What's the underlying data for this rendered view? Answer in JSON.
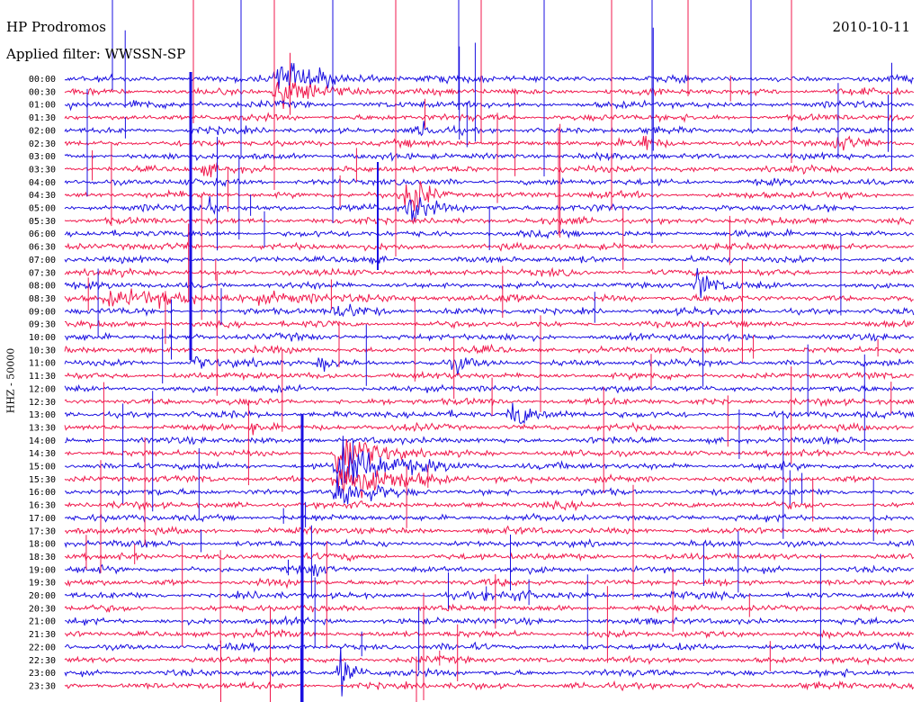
{
  "header": {
    "station": "HP Prodromos",
    "filter": "Applied filter: WWSSN-SP",
    "date": "2010-10-11",
    "channel": "HHZ - 50000"
  },
  "colors": {
    "trace_a": "#1a0fe0",
    "trace_b": "#f0184c",
    "background": "#ffffff",
    "text": "#000000"
  },
  "chart_data": {
    "type": "line",
    "title": "HP Prodromos",
    "subtitle": "Applied filter: WWSSN-SP",
    "date": "2010-10-11",
    "ylabel": "HHZ - 50000",
    "grid": false,
    "rows": [
      "00:00",
      "00:30",
      "01:00",
      "01:30",
      "02:00",
      "02:30",
      "03:00",
      "03:30",
      "04:00",
      "04:30",
      "05:00",
      "05:30",
      "06:00",
      "06:30",
      "07:00",
      "07:30",
      "08:00",
      "08:30",
      "09:00",
      "09:30",
      "10:00",
      "10:30",
      "11:00",
      "11:30",
      "12:00",
      "12:30",
      "13:00",
      "13:30",
      "14:00",
      "14:30",
      "15:00",
      "15:30",
      "16:00",
      "16:30",
      "17:00",
      "17:30",
      "18:00",
      "18:30",
      "19:00",
      "19:30",
      "20:00",
      "20:30",
      "21:00",
      "21:30",
      "22:00",
      "22:30",
      "23:00",
      "23:30"
    ],
    "row_span_minutes": 30,
    "series": [
      {
        "color": "blue",
        "rows": "even (00 minutes)"
      },
      {
        "color": "red",
        "rows": "odd (30 minutes)"
      }
    ],
    "events": [
      {
        "row": "00:00",
        "x_fraction": 0.25,
        "amplitude": 2.2,
        "spread": 0.045
      },
      {
        "row": "00:30",
        "x_fraction": 0.25,
        "amplitude": 1.8,
        "spread": 0.04
      },
      {
        "row": "01:00",
        "x_fraction": 0.08,
        "amplitude": 0.8,
        "spread": 0.02
      },
      {
        "row": "02:00",
        "x_fraction": 0.42,
        "amplitude": 1.0,
        "spread": 0.01
      },
      {
        "row": "02:30",
        "x_fraction": 0.68,
        "amplitude": 1.1,
        "spread": 0.01
      },
      {
        "row": "02:30",
        "x_fraction": 0.91,
        "amplitude": 1.3,
        "spread": 0.012
      },
      {
        "row": "03:30",
        "x_fraction": 0.165,
        "amplitude": 0.9,
        "spread": 0.01
      },
      {
        "row": "04:30",
        "x_fraction": 0.405,
        "amplitude": 3.5,
        "spread": 0.015
      },
      {
        "row": "05:00",
        "x_fraction": 0.405,
        "amplitude": 2.6,
        "spread": 0.02
      },
      {
        "row": "05:00",
        "x_fraction": 0.17,
        "amplitude": 1.6,
        "spread": 0.006
      },
      {
        "row": "08:00",
        "x_fraction": 0.745,
        "amplitude": 2.6,
        "spread": 0.012
      },
      {
        "row": "08:30",
        "x_fraction": 0.05,
        "amplitude": 0.7,
        "spread": 0.2
      },
      {
        "row": "09:00",
        "x_fraction": 0.32,
        "amplitude": 0.9,
        "spread": 0.03
      },
      {
        "row": "11:00",
        "x_fraction": 0.15,
        "amplitude": 1.2,
        "spread": 0.012
      },
      {
        "row": "11:00",
        "x_fraction": 0.3,
        "amplitude": 1.0,
        "spread": 0.012
      },
      {
        "row": "11:00",
        "x_fraction": 0.46,
        "amplitude": 0.9,
        "spread": 0.01
      },
      {
        "row": "13:00",
        "x_fraction": 0.525,
        "amplitude": 2.4,
        "spread": 0.02
      },
      {
        "row": "13:30",
        "x_fraction": 0.22,
        "amplitude": 0.8,
        "spread": 0.015
      },
      {
        "row": "14:30",
        "x_fraction": 0.32,
        "amplitude": 3.8,
        "spread": 0.03
      },
      {
        "row": "15:00",
        "x_fraction": 0.32,
        "amplitude": 3.2,
        "spread": 0.05
      },
      {
        "row": "15:30",
        "x_fraction": 0.32,
        "amplitude": 2.8,
        "spread": 0.05
      },
      {
        "row": "16:00",
        "x_fraction": 0.32,
        "amplitude": 2.2,
        "spread": 0.03
      },
      {
        "row": "19:00",
        "x_fraction": 0.29,
        "amplitude": 0.9,
        "spread": 0.008
      },
      {
        "row": "20:00",
        "x_fraction": 0.52,
        "amplitude": 0.8,
        "spread": 0.025
      },
      {
        "row": "23:00",
        "x_fraction": 0.325,
        "amplitude": 3.0,
        "spread": 0.012
      }
    ]
  }
}
